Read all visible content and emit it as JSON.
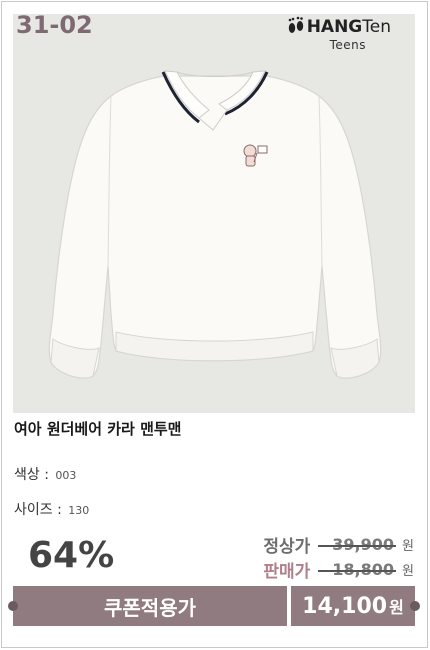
{
  "product": {
    "code": "31-02",
    "brand": {
      "name_bold": "HANG",
      "name_light": "Ten",
      "sub": "Teens"
    },
    "name": "여아 원더베어 카라 맨투맨",
    "color_label": "색상",
    "color_value": "003",
    "size_label": "사이즈",
    "size_value": "130",
    "discount": "64%",
    "regular_label": "정상가",
    "regular_price": "39,900",
    "sale_label": "판매가",
    "sale_price": "18,800",
    "currency": "원",
    "coupon_label": "쿠폰적용가",
    "final_price": "14,100",
    "final_currency": "원"
  },
  "colors": {
    "accent": "#8f7b80",
    "sale_label": "#b07f8b",
    "photo_bg": "#e7e7e4"
  }
}
